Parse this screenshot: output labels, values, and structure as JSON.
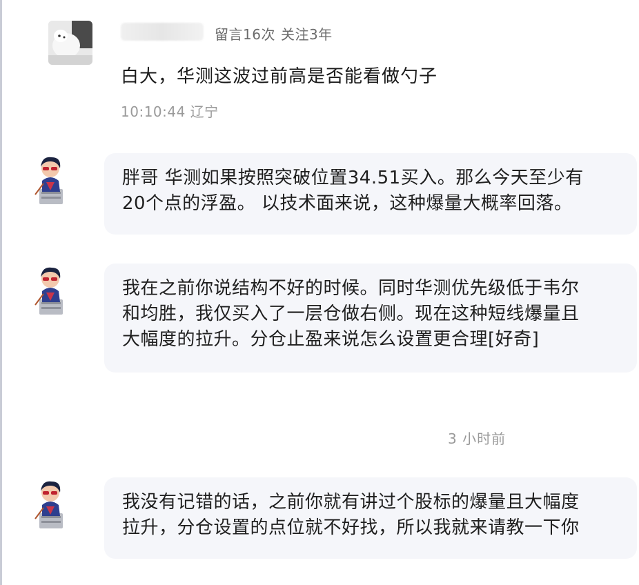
{
  "comment": {
    "meta": [
      "留言16次",
      "关注3年"
    ],
    "text": "白大，华测这波过前高是否能看做勺子",
    "time": "10:10:44 辽宁"
  },
  "replies": [
    {
      "lines": [
        "胖哥 华测如果按照突破位置34.51买入。那么今天至少有",
        "20个点的浮盈。 以技术面来说，这种爆量大概率回落。"
      ]
    },
    {
      "lines": [
        "我在之前你说结构不好的时候。同时华测优先级低于韦尔",
        "和均胜，我仅买入了一层仓做右侧。现在这种短线爆量且",
        "大幅度的拉升。分仓止盈来说怎么设置更合理[好奇]"
      ]
    },
    {
      "lines": [
        "我没有记错的话，之前你就有讲过个股标的爆量且大幅度",
        "拉升，分仓设置的点位就不好找，所以我就来请教一下你"
      ]
    }
  ],
  "divider": {
    "time": "3 小时前"
  }
}
